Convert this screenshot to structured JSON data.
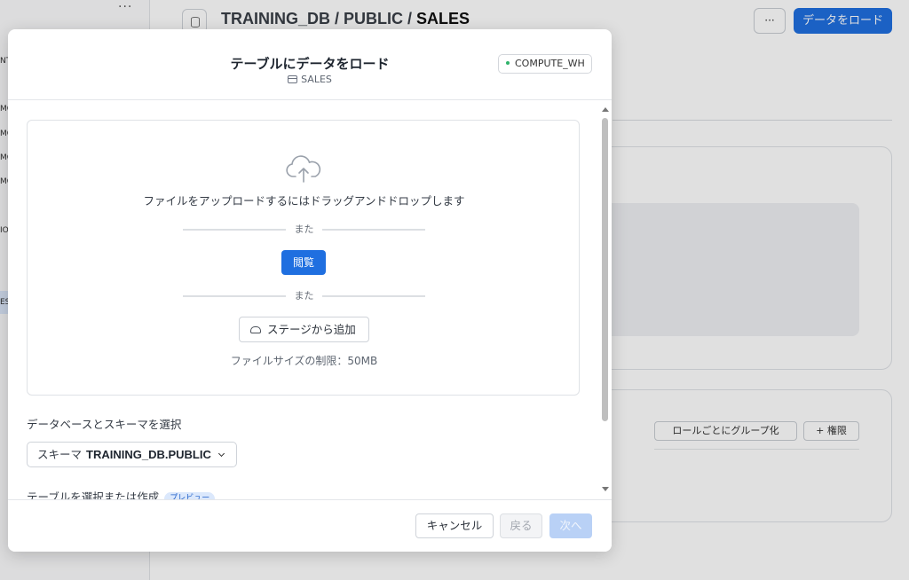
{
  "background": {
    "breadcrumb": [
      "TRAINING_DB",
      "PUBLIC",
      "SALES"
    ],
    "breadcrumb_separator": " / ",
    "sidebar_more": "···",
    "sidebar_fragments": [
      "NT",
      "MO",
      "MO",
      "MO",
      "MO",
      "IO",
      "ES"
    ],
    "header_more": "···",
    "load_data_button": "データをロード",
    "group_by_role": "ロールごとにグループ化",
    "permission_button": "+ 権限"
  },
  "modal": {
    "title": "テーブルにデータをロード",
    "subtitle": "SALES",
    "warehouse": "COMPUTE_WH",
    "dropzone": {
      "instruction": "ファイルをアップロードするにはドラッグアンドドロップします",
      "or_1": "また",
      "browse": "閲覧",
      "or_2": "また",
      "add_from_stage": "ステージから追加",
      "size_limit": "ファイルサイズの制限：50MB"
    },
    "db_schema_label": "データベースとスキーマを選択",
    "schema_select": {
      "prefix": "スキーマ",
      "value": "TRAINING_DB.PUBLIC"
    },
    "table_label": "テーブルを選択または作成",
    "preview_badge": "プレビュー",
    "footer": {
      "cancel": "キャンセル",
      "back": "戻る",
      "next": "次へ"
    }
  },
  "colors": {
    "primary": "#1f6fe0",
    "primary_disabled": "#b9d1f6",
    "status_dot": "#2fb36a"
  }
}
